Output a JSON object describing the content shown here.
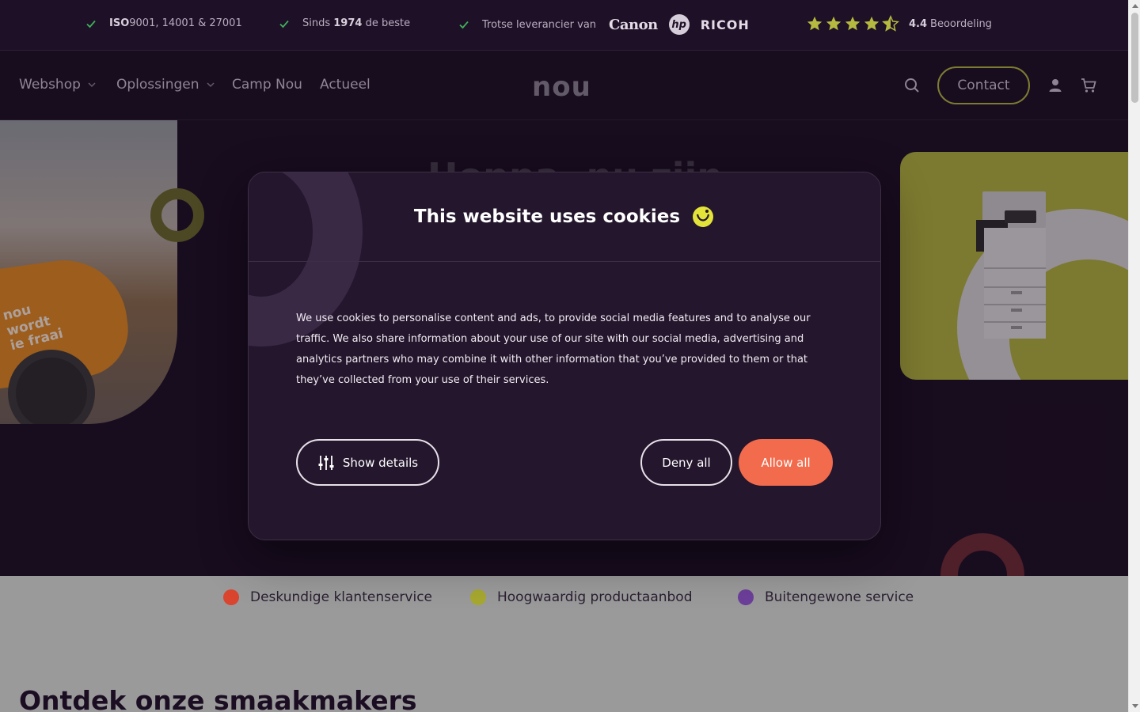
{
  "topbar": {
    "trust_items": [
      {
        "bold": "ISO",
        "text": " 9001, 14001 & 27001"
      },
      {
        "prefix": "Sinds ",
        "bold": "1974",
        "text": " de beste"
      },
      {
        "text": "Trotse leverancier van"
      }
    ],
    "brand_logos": [
      "Canon",
      "hp",
      "RICOH"
    ],
    "rating": {
      "score": "4.4",
      "label": "Beoordeling",
      "stars_value": 4.5,
      "stars_max": 5
    }
  },
  "nav": {
    "items": [
      {
        "label": "Webshop",
        "has_dropdown": true
      },
      {
        "label": "Oplossingen",
        "has_dropdown": true
      },
      {
        "label": "Camp Nou",
        "has_dropdown": false
      },
      {
        "label": "Actueel",
        "has_dropdown": false
      }
    ],
    "logo": "nou",
    "contact_label": "Contact"
  },
  "hero": {
    "title_partial": "Hoppa, nu zijn",
    "photo_tagline": [
      "nou",
      "wordt",
      "ie fraai"
    ]
  },
  "usps": [
    {
      "label": "Deskundige klantenservice",
      "color": "#d9452f"
    },
    {
      "label": "Hoogwaardig productaanbod",
      "color": "#a6a830"
    },
    {
      "label": "Buitengewone service",
      "color": "#6c3f9a"
    }
  ],
  "lower": {
    "title": "Ontdek onze smaakmakers"
  },
  "cookie_dialog": {
    "title": "This website uses cookies",
    "body": "We use cookies to personalise content and ads, to provide social media features and to analyse our traffic. We also share information about your use of our site with our social media, advertising and analytics partners who may combine it with other information that you’ve provided to them or that they’ve collected from your use of their services.",
    "show_details_label": "Show details",
    "deny_label": "Deny all",
    "allow_label": "Allow all"
  },
  "colors": {
    "background": "#1b0e22",
    "accent_yellow": "#b6b940",
    "accent_orange": "#f26b4c",
    "dialog_bg": "#24162d"
  }
}
